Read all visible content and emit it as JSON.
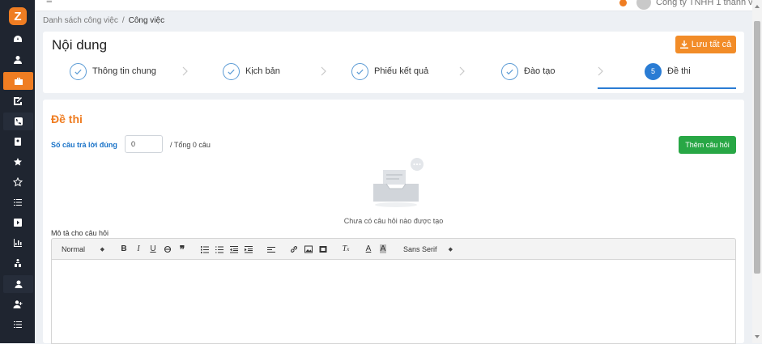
{
  "app": {
    "logo_letter": "Z"
  },
  "topbar": {
    "menu_icon": "hamburger-icon",
    "company": "Công ty TNHH 1 thành viên"
  },
  "breadcrumb": {
    "parent": "Danh sách công việc",
    "separator": "/",
    "current": "Công việc"
  },
  "header": {
    "title": "Nội dung",
    "save_all": "Lưu tất cả"
  },
  "steps": [
    {
      "label": "Thông tin chung",
      "state": "done"
    },
    {
      "label": "Kịch bản",
      "state": "done"
    },
    {
      "label": "Phiếu kết quả",
      "state": "done"
    },
    {
      "label": "Đào tạo",
      "state": "done"
    },
    {
      "label": "Đề thi",
      "state": "active",
      "number": "5"
    }
  ],
  "exam": {
    "title": "Đề thi",
    "correct_label": "Số câu trả lời đúng",
    "correct_value": "0",
    "total_label": "/ Tổng 0 câu",
    "add_question": "Thêm câu hỏi",
    "empty_text": "Chưa có câu hỏi nào được tạo",
    "description_label": "Mô tả cho câu hỏi"
  },
  "editor_toolbar": {
    "heading_select": "Normal",
    "font_select": "Sans Serif"
  },
  "sidebar": {
    "items": [
      "dashboard-icon",
      "user-icon",
      "briefcase-icon",
      "edit-icon",
      "phone-icon",
      "contact-card-icon",
      "star-badge-icon",
      "star-icon",
      "list-icon",
      "play-icon",
      "chart-icon",
      "org-icon",
      "support-icon",
      "add-user-icon",
      "list-icon-2"
    ]
  },
  "colors": {
    "accent": "#ef7d22",
    "primary": "#2a7cd4",
    "success": "#28a745",
    "sidebar": "#1f2530"
  }
}
